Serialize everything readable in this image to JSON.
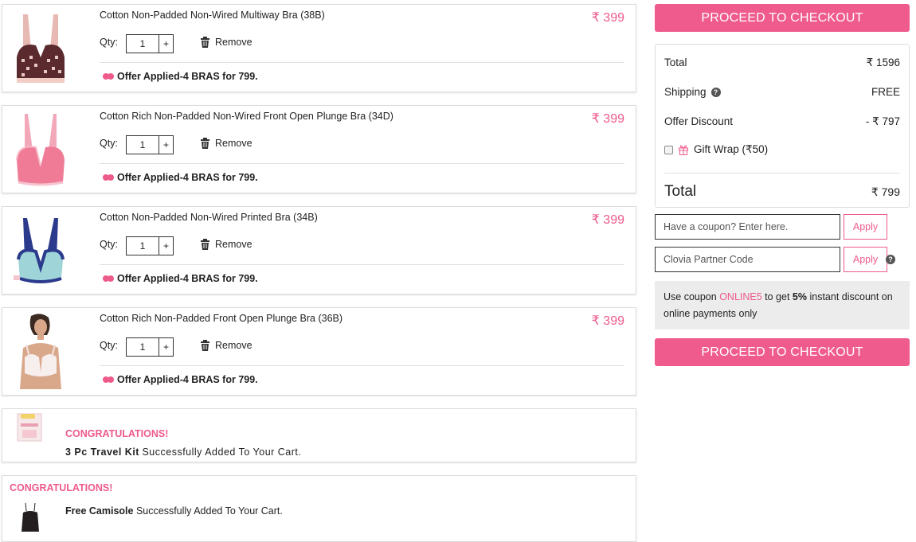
{
  "currency_symbol": "₹",
  "items": [
    {
      "name": "Cotton Non-Padded Non-Wired Multiway Bra (38B)",
      "price": "₹ 399",
      "qty_label": "Qty:",
      "qty": "1",
      "plus": "+",
      "remove": "Remove",
      "offer": "Offer Applied-4 BRAS for 799."
    },
    {
      "name": "Cotton Rich Non-Padded Non-Wired Front Open Plunge Bra (34D)",
      "price": "₹ 399",
      "qty_label": "Qty:",
      "qty": "1",
      "plus": "+",
      "remove": "Remove",
      "offer": "Offer Applied-4 BRAS for 799."
    },
    {
      "name": "Cotton Non-Padded Non-Wired Printed Bra (34B)",
      "price": "₹ 399",
      "qty_label": "Qty:",
      "qty": "1",
      "plus": "+",
      "remove": "Remove",
      "offer": "Offer Applied-4 BRAS for 799."
    },
    {
      "name": "Cotton Rich Non-Padded Front Open Plunge Bra (36B)",
      "price": "₹ 399",
      "qty_label": "Qty:",
      "qty": "1",
      "plus": "+",
      "remove": "Remove",
      "offer": "Offer Applied-4 BRAS for 799."
    }
  ],
  "congrats": [
    {
      "title": "CONGRATULATIONS!",
      "product": "3 Pc Travel Kit",
      "message": "Successfully Added To Your Cart."
    },
    {
      "title": "CONGRATULATIONS!",
      "product": "Free Camisole",
      "message": "Successfully Added To Your Cart."
    }
  ],
  "checkout_label": "PROCEED TO CHECKOUT",
  "summary": {
    "total_label": "Total",
    "total_value": "₹ 1596",
    "shipping_label": "Shipping",
    "shipping_value": "FREE",
    "discount_label": "Offer Discount",
    "discount_value": "- ₹ 797",
    "gift_wrap_label": "Gift Wrap (₹50)",
    "grand_label": "Total",
    "grand_value": "₹ 799"
  },
  "coupon": {
    "placeholder": "Have a coupon? Enter here.",
    "apply": "Apply"
  },
  "partner": {
    "placeholder": "Clovia Partner Code",
    "apply": "Apply"
  },
  "promo": {
    "prefix": "Use coupon ",
    "code": "ONLINE5",
    "mid": " to get ",
    "percent": "5%",
    "suffix": " instant discount on online payments only"
  },
  "icons": {
    "help": "question-circle-icon",
    "trash": "trash-icon",
    "gift": "gift-icon",
    "offer": "offer-dots-icon"
  },
  "colors": {
    "accent": "#ef5b8c",
    "promo_bg": "#ececec"
  }
}
